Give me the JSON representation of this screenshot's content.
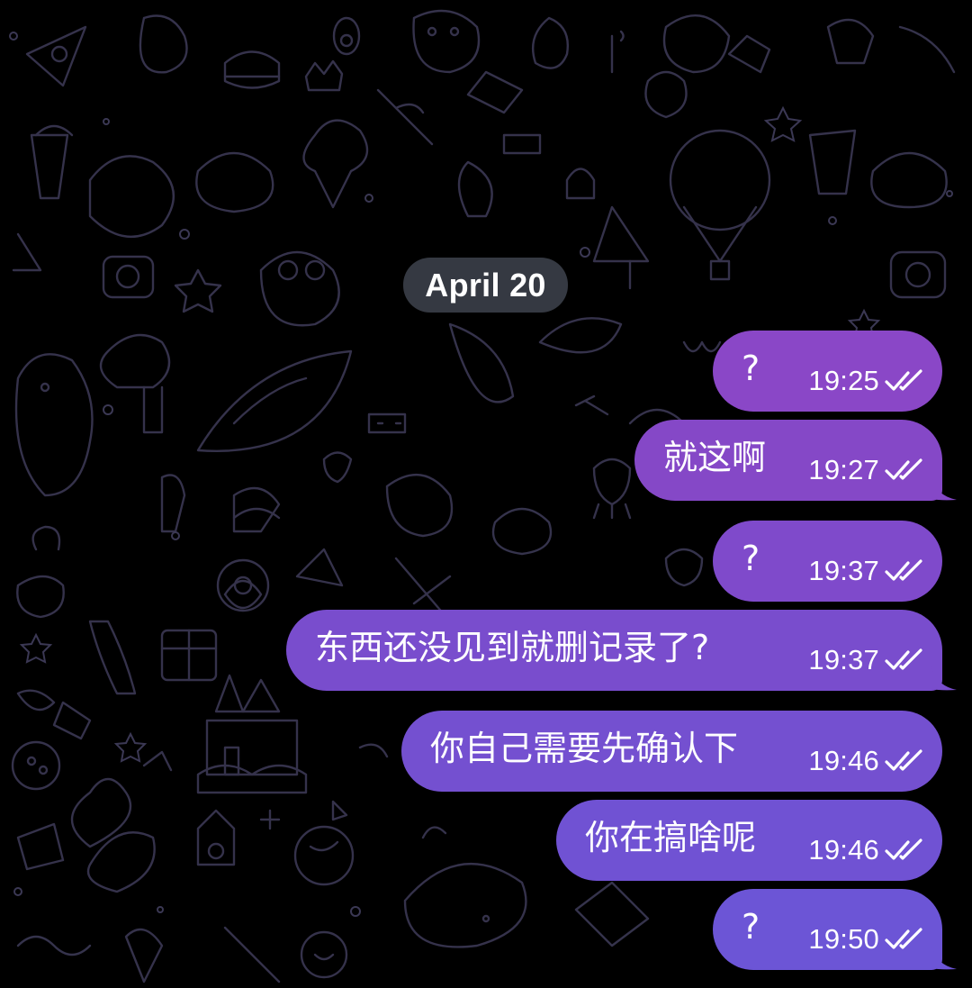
{
  "date_separator": "April 20",
  "colors": {
    "background": "#000000",
    "bubble_top": "#8a47c7",
    "bubble_bottom": "#6f55d8",
    "date_pill": "#3a3e48",
    "doodle_stroke": "#3b3854"
  },
  "messages": [
    {
      "text": "?",
      "time": "19:25",
      "status": "read-double-check-icon"
    },
    {
      "text": "就这啊",
      "time": "19:27",
      "status": "read-double-check-icon"
    },
    {
      "text": "?",
      "time": "19:37",
      "status": "read-double-check-icon"
    },
    {
      "text": "东西还没见到就删记录了?",
      "time": "19:37",
      "status": "read-double-check-icon"
    },
    {
      "text": "你自己需要先确认下",
      "time": "19:46",
      "status": "read-double-check-icon"
    },
    {
      "text": "你在搞啥呢",
      "time": "19:46",
      "status": "read-double-check-icon"
    },
    {
      "text": "?",
      "time": "19:50",
      "status": "read-double-check-icon"
    }
  ]
}
